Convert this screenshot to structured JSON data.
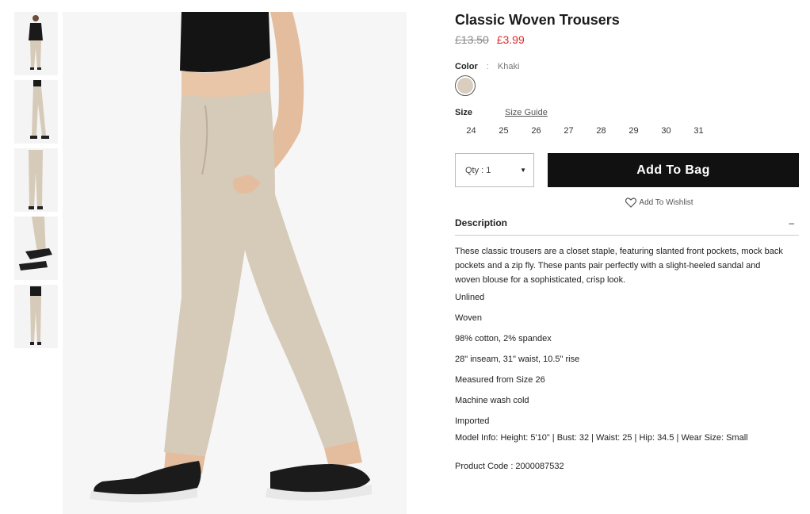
{
  "product": {
    "title": "Classic Woven Trousers",
    "price_old": "£13.50",
    "price_new": "£3.99"
  },
  "color": {
    "label": "Color",
    "separator": ":",
    "value": "Khaki",
    "swatch_hex": "#d9cdbf"
  },
  "size": {
    "label": "Size",
    "guide_label": "Size Guide",
    "options": [
      "24",
      "25",
      "26",
      "27",
      "28",
      "29",
      "30",
      "31"
    ]
  },
  "purchase": {
    "qty_label": "Qty : 1",
    "add_to_bag": "Add To Bag",
    "wishlist": "Add To Wishlist"
  },
  "description": {
    "title": "Description",
    "toggle": "–",
    "text": "These classic trousers are a closet staple, featuring slanted front pockets, mock back pockets and a zip fly. These pants pair perfectly with a slight-heeled sandal and woven blouse for a sophisticated, crisp look.",
    "features": [
      "Unlined",
      "Woven",
      "98% cotton, 2% spandex",
      "28\" inseam, 31\" waist, 10.5\" rise",
      "Measured from Size 26",
      "Machine wash cold",
      "Imported"
    ],
    "model_info": "Model Info: Height: 5'10\" | Bust: 32 | Waist: 25 | Hip: 34.5 | Wear Size: Small",
    "product_code": "Product Code : 2000087532"
  },
  "colors": {
    "price_sale": "#e02b2b",
    "button_bg": "#111111",
    "trouser_khaki": "#d6cab9"
  }
}
